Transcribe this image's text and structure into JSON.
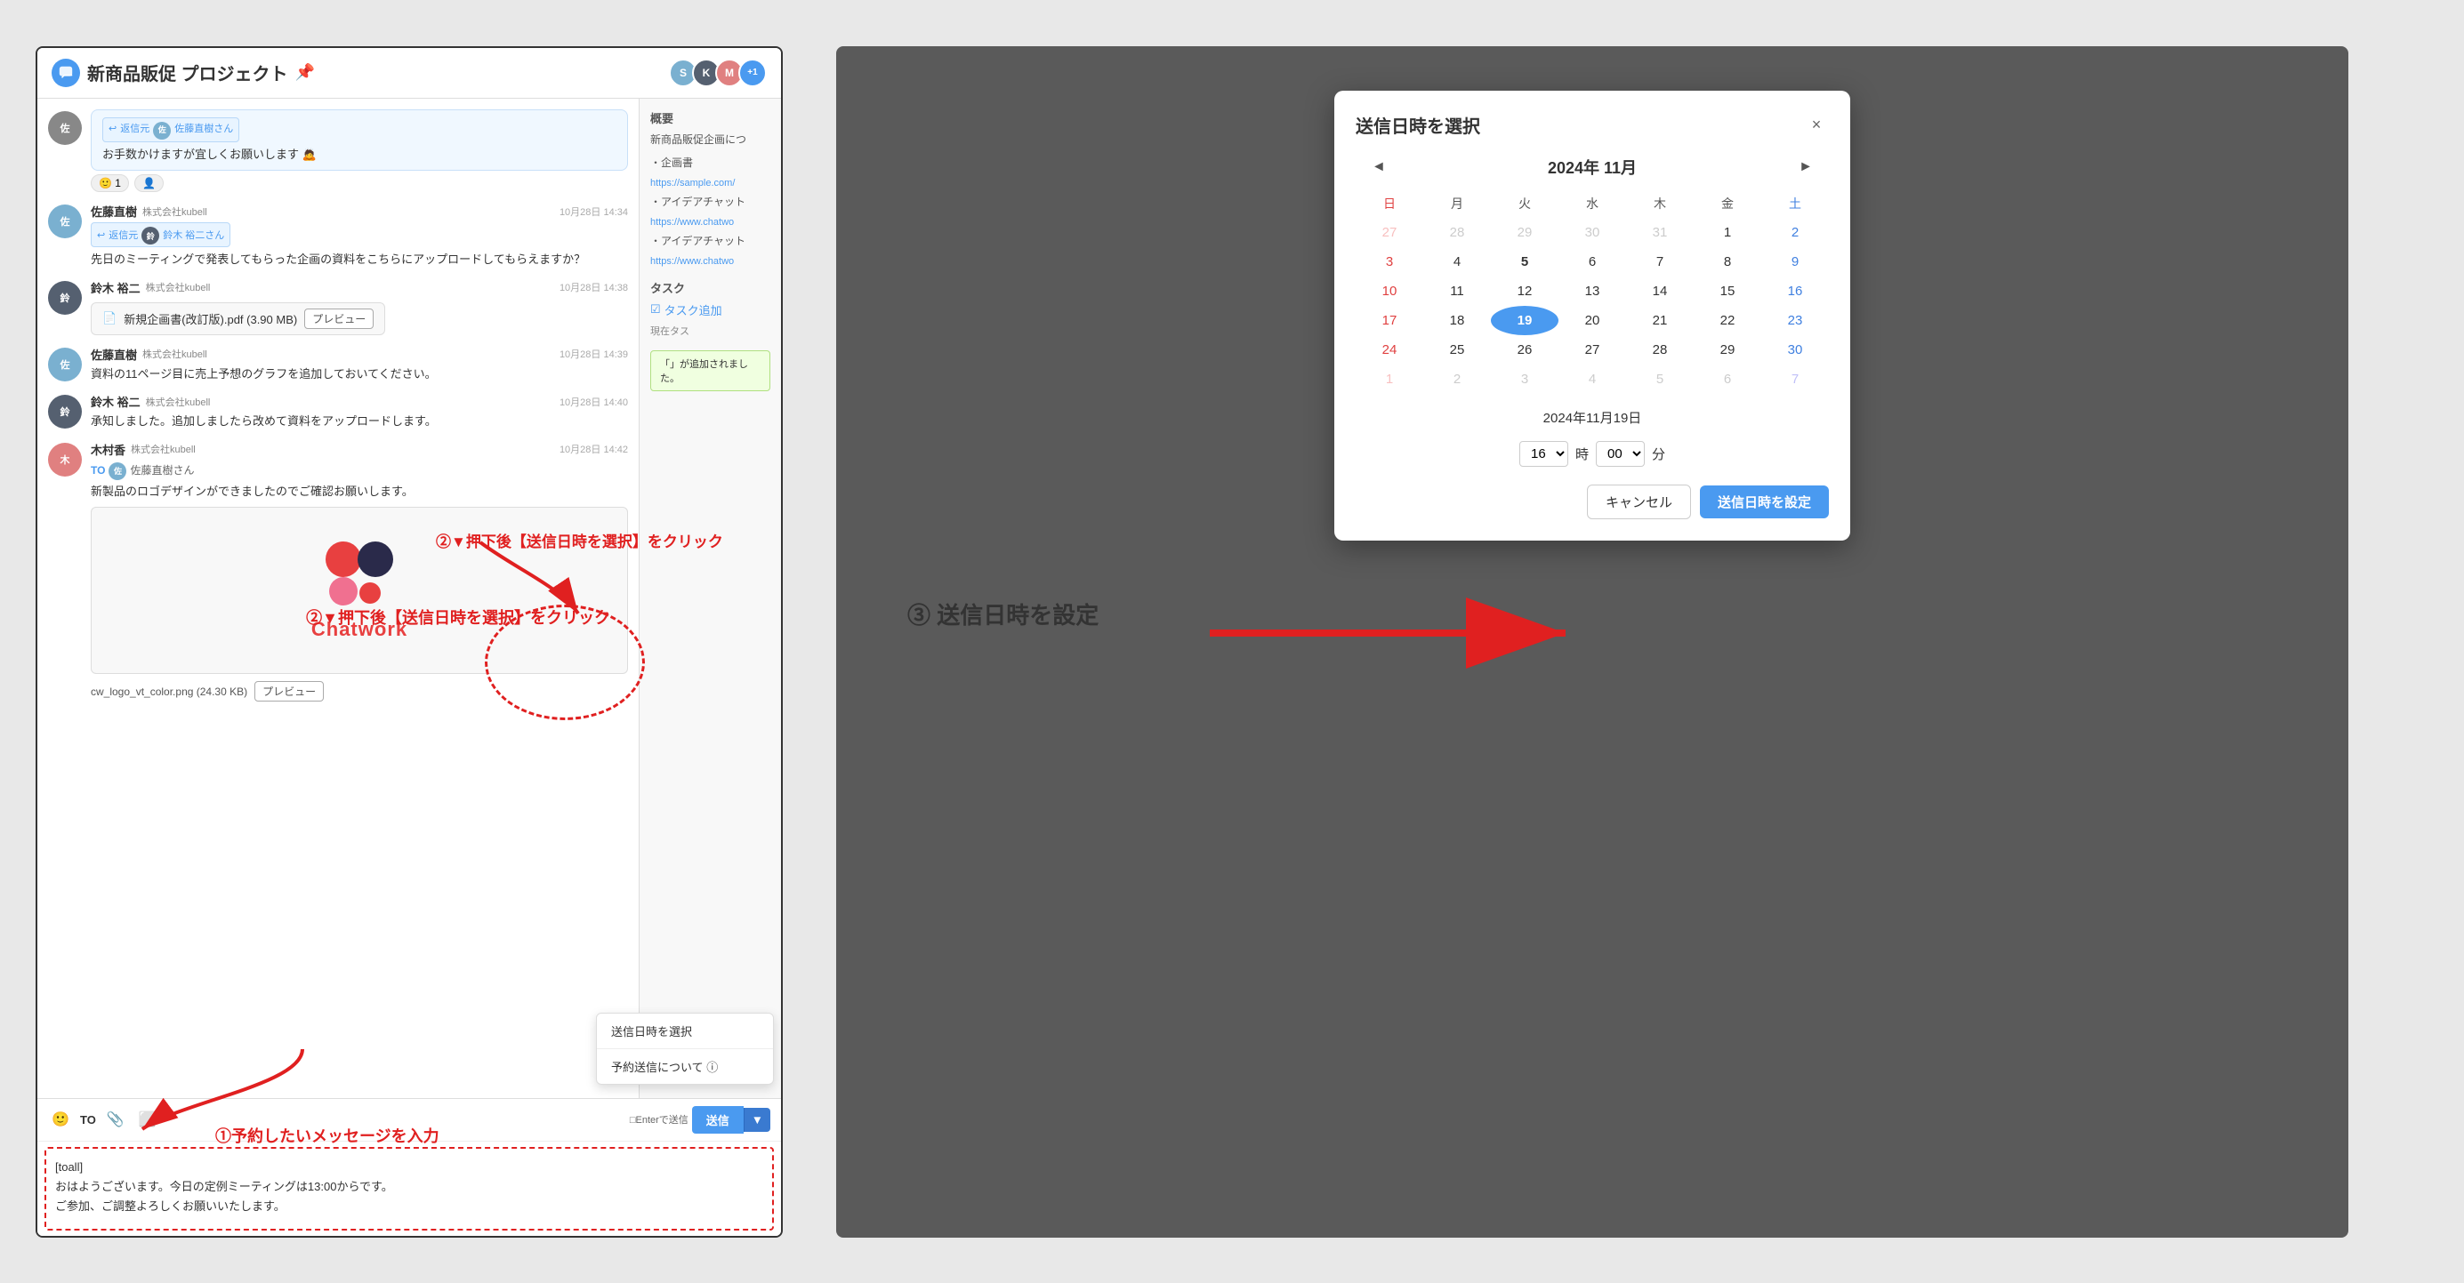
{
  "chatWindow": {
    "title": "新商品販促 プロジェクト",
    "messages": [
      {
        "id": "msg1",
        "avatar_color": "#888",
        "name": "佐藤直樹",
        "company": "",
        "time": "",
        "reply_to": "返信元",
        "reply_name": "佐藤直樹さん",
        "text": "お手数かけますが宜しくお願いします 🙇",
        "reaction": "1",
        "style": "bubble"
      },
      {
        "id": "msg2",
        "avatar_color": "#7ab0d0",
        "name": "佐藤直樹",
        "company": "株式会社kubell",
        "time": "10月28日 14:34",
        "reply_to": "返信元",
        "reply_name": "鈴木 裕二さん",
        "text": "先日のミーティングで発表してもらった企画の資料をこちらにアップロードしてもらえますか？",
        "style": "normal"
      },
      {
        "id": "msg3",
        "avatar_color": "#556070",
        "name": "鈴木 裕二",
        "company": "株式会社kubell",
        "time": "10月28日 14:38",
        "file_name": "新規企画書(改訂版).pdf (3.90 MB)",
        "preview_label": "プレビュー",
        "style": "file"
      },
      {
        "id": "msg4",
        "avatar_color": "#7ab0d0",
        "name": "佐藤直樹",
        "company": "株式会社kubell",
        "time": "10月28日 14:39",
        "text": "資料の11ページ目に売上予想のグラフを追加しておいてください。",
        "style": "normal"
      },
      {
        "id": "msg5",
        "avatar_color": "#556070",
        "name": "鈴木 裕二",
        "company": "株式会社kubell",
        "time": "10月28日 14:40",
        "text": "承知しました。追加しましたら改めて資料をアップロードします。",
        "style": "normal"
      },
      {
        "id": "msg6",
        "avatar_color": "#e08080",
        "name": "木村香",
        "company": "株式会社kubell",
        "time": "10月28日 14:42",
        "to_label": "TO",
        "to_name": "佐藤直樹さん",
        "text": "新製品のロゴデザインができましたのでご確認お願いします。",
        "has_image": true,
        "image_file": "cw_logo_vt_color.png (24.30 KB)",
        "style": "to_message"
      }
    ],
    "sidebar": {
      "overview_title": "概要",
      "overview_text": "新商品販促企画につ",
      "planning_label": "・企画書",
      "planning_link": "https://sample.com/",
      "idea_chat_label": "・アイデアチャット",
      "idea_link1": "https://www.chatwo",
      "idea_chat_label2": "・アイデアチャット",
      "idea_link2": "https://www.chatwo",
      "task_title": "タスク",
      "task_add_label": "タスク追加",
      "notification": "「」が追加されました。"
    },
    "compose": {
      "to_label": "TO",
      "enter_label": "□Enterで送信",
      "send_label": "送信",
      "text": "[toall]\nおはようございます。今日の定例ミーティングは13:00からです。\nご参加、ご調整よろしくお願いいたします。",
      "dropdown_items": [
        {
          "label": "送信日時を選択",
          "id": "schedule-send"
        },
        {
          "label": "予約送信について ⓘ",
          "id": "about-schedule"
        }
      ]
    }
  },
  "annotations": {
    "step1_text": "①予約したいメッセージを入力",
    "step2_text": "②▼押下後【送信日時を選択】をクリック",
    "step3_text": "③ 送信日時を設定"
  },
  "modal": {
    "title": "送信日時を選択",
    "close_label": "×",
    "month_year": "2024年 11月",
    "prev_label": "◄",
    "next_label": "►",
    "weekdays": [
      "日",
      "月",
      "火",
      "水",
      "木",
      "金",
      "土"
    ],
    "weeks": [
      [
        {
          "day": "27",
          "other": true
        },
        {
          "day": "28",
          "other": true
        },
        {
          "day": "29",
          "other": true
        },
        {
          "day": "30",
          "other": true
        },
        {
          "day": "31",
          "other": true
        },
        {
          "day": "1",
          "other": false
        },
        {
          "day": "2",
          "other": false
        }
      ],
      [
        {
          "day": "3",
          "other": false
        },
        {
          "day": "4",
          "other": false
        },
        {
          "day": "5",
          "bold": true,
          "other": false
        },
        {
          "day": "6",
          "other": false
        },
        {
          "day": "7",
          "other": false
        },
        {
          "day": "8",
          "other": false
        },
        {
          "day": "9",
          "other": false
        }
      ],
      [
        {
          "day": "10",
          "other": false
        },
        {
          "day": "11",
          "other": false
        },
        {
          "day": "12",
          "other": false
        },
        {
          "day": "13",
          "other": false
        },
        {
          "day": "14",
          "other": false
        },
        {
          "day": "15",
          "other": false
        },
        {
          "day": "16",
          "other": false
        }
      ],
      [
        {
          "day": "17",
          "other": false
        },
        {
          "day": "18",
          "other": false
        },
        {
          "day": "19",
          "today": true,
          "other": false
        },
        {
          "day": "20",
          "other": false
        },
        {
          "day": "21",
          "other": false
        },
        {
          "day": "22",
          "other": false
        },
        {
          "day": "23",
          "other": false
        }
      ],
      [
        {
          "day": "24",
          "other": false
        },
        {
          "day": "25",
          "other": false
        },
        {
          "day": "26",
          "other": false
        },
        {
          "day": "27",
          "other": false
        },
        {
          "day": "28",
          "other": false
        },
        {
          "day": "29",
          "other": false
        },
        {
          "day": "30",
          "other": false
        }
      ],
      [
        {
          "day": "1",
          "other": true
        },
        {
          "day": "2",
          "other": true
        },
        {
          "day": "3",
          "other": true
        },
        {
          "day": "4",
          "other": true
        },
        {
          "day": "5",
          "other": true
        },
        {
          "day": "6",
          "other": true
        },
        {
          "day": "7",
          "other": true
        }
      ]
    ],
    "selected_date_label": "2024年11月19日",
    "hour_value": "16",
    "minute_value": "00",
    "hour_label": "時",
    "minute_label": "分",
    "cancel_label": "キャンセル",
    "set_label": "送信日時を設定"
  }
}
